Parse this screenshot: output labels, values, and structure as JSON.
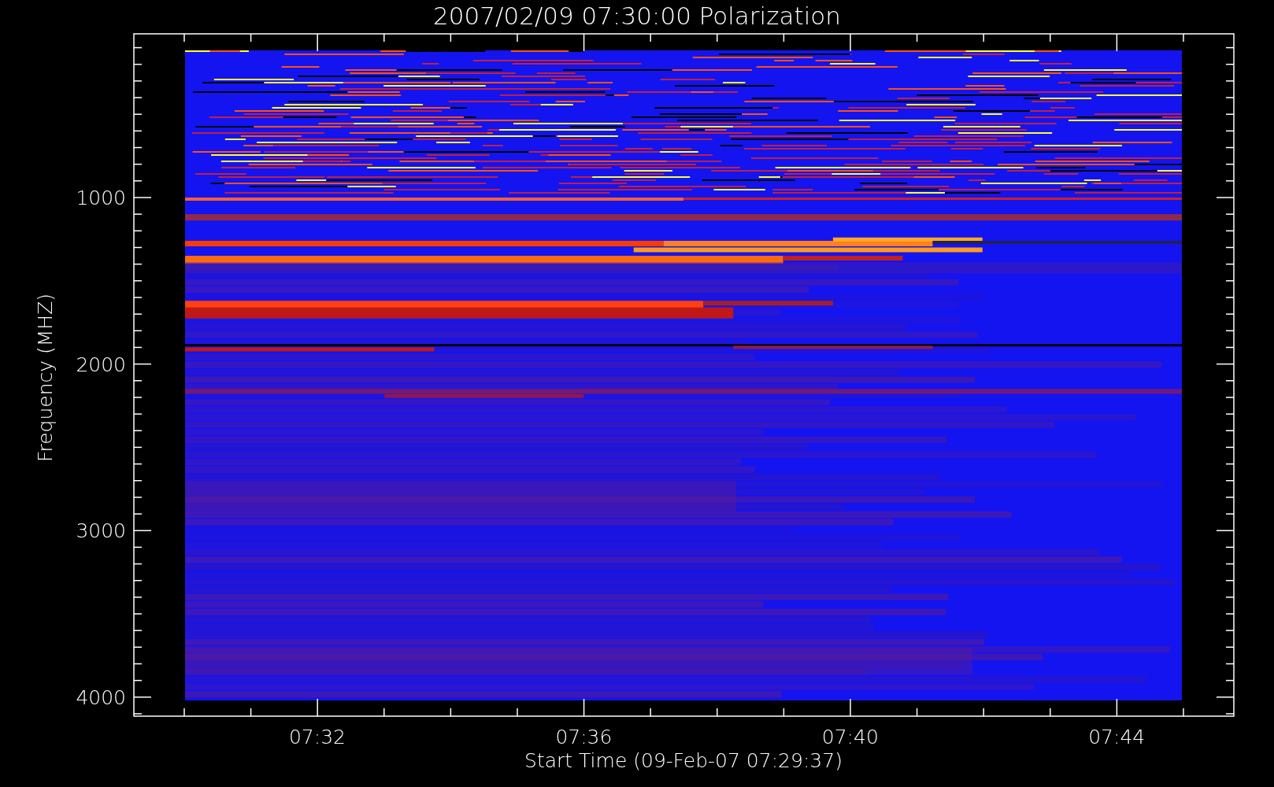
{
  "plot": {
    "title": "2007/02/09 07:30:00 Polarization",
    "ylabel": "Frequency (MHZ)",
    "xlabel": "Start Time (09-Feb-07 07:29:37)",
    "y_tick_labels": [
      "1000",
      "2000",
      "3000",
      "4000"
    ],
    "x_tick_labels": [
      "07:32",
      "07:36",
      "07:40",
      "07:44"
    ]
  }
}
